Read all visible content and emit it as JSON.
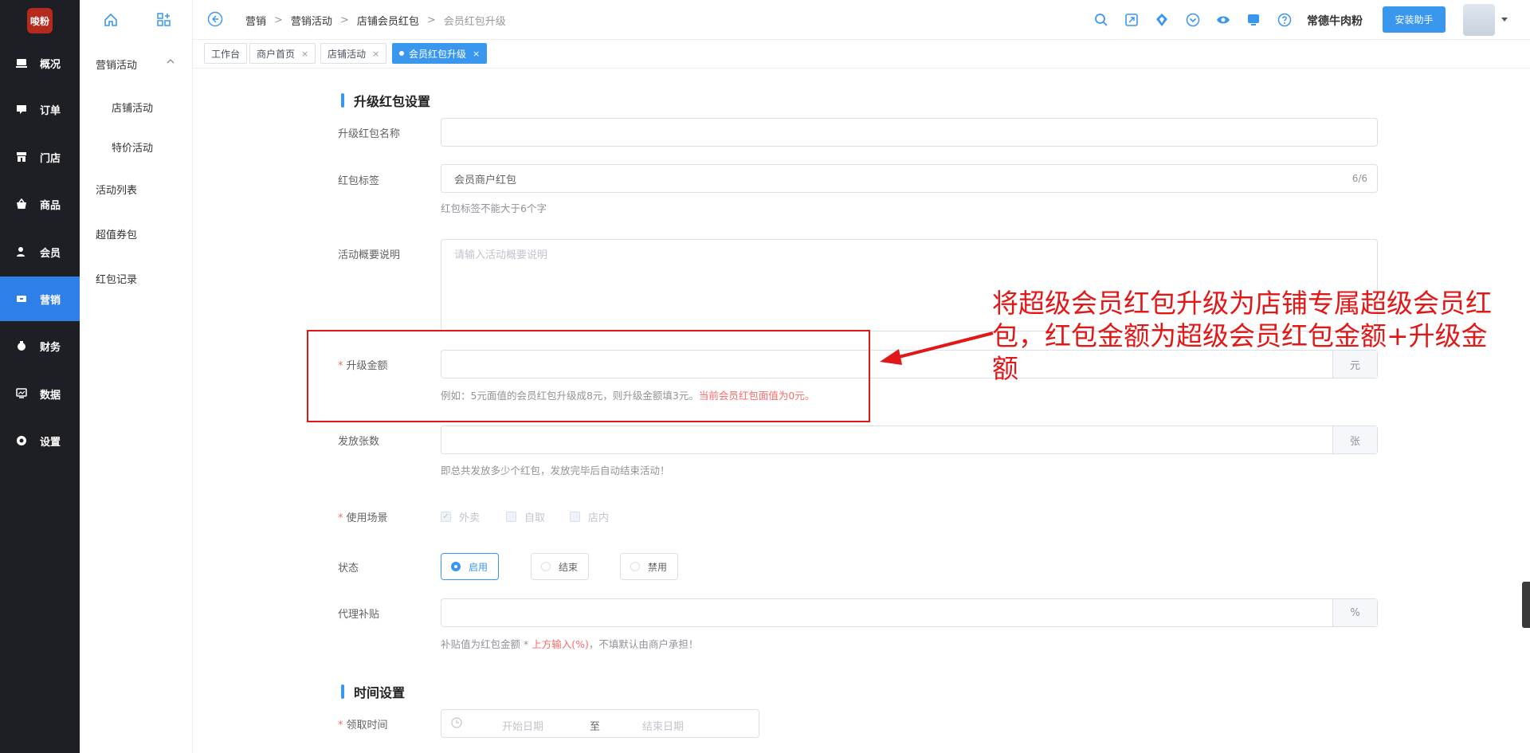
{
  "app": {
    "logo_text": "唆粉"
  },
  "nav": {
    "items": [
      {
        "label": "概况",
        "icon": "overview-icon"
      },
      {
        "label": "订单",
        "icon": "order-icon"
      },
      {
        "label": "门店",
        "icon": "store-icon"
      },
      {
        "label": "商品",
        "icon": "goods-icon"
      },
      {
        "label": "会员",
        "icon": "member-icon"
      },
      {
        "label": "营销",
        "icon": "marketing-icon",
        "active": true
      },
      {
        "label": "财务",
        "icon": "finance-icon"
      },
      {
        "label": "数据",
        "icon": "data-icon"
      },
      {
        "label": "设置",
        "icon": "settings-icon"
      }
    ]
  },
  "subnav": {
    "group": "营销活动",
    "children": [
      "店铺活动",
      "特价活动"
    ],
    "items": [
      "活动列表",
      "超值券包",
      "红包记录"
    ]
  },
  "breadcrumb": {
    "items": [
      "营销",
      "营销活动",
      "店铺会员红包"
    ],
    "current": "会员红包升级"
  },
  "header": {
    "shop_name": "常德牛肉粉",
    "helper_button": "安装助手"
  },
  "tabs": [
    {
      "label": "工作台",
      "closable": false
    },
    {
      "label": "商户首页",
      "closable": true
    },
    {
      "label": "店铺活动",
      "closable": true
    },
    {
      "label": "会员红包升级",
      "closable": true,
      "active": true
    }
  ],
  "form": {
    "section1_title": "升级红包设置",
    "name_label": "升级红包名称",
    "name_value": "",
    "tag_label": "红包标签",
    "tag_value": "会员商户红包",
    "tag_count": "6/6",
    "tag_hint": "红包标签不能大于6个字",
    "desc_label": "活动概要说明",
    "desc_placeholder": "请输入活动概要说明",
    "amount_label": "升级金额",
    "amount_suffix": "元",
    "amount_hint": "例如：5元面值的会员红包升级成8元，则升级金额填3元。",
    "amount_hint_red": "当前会员红包面值为0元。",
    "qty_label": "发放张数",
    "qty_suffix": "张",
    "qty_hint": "即总共发放多少个红包，发放完毕后自动结束活动！",
    "scene_label": "使用场景",
    "scene_options": [
      "外卖",
      "自取",
      "店内"
    ],
    "status_label": "状态",
    "status_options": [
      "启用",
      "结束",
      "禁用"
    ],
    "status_selected": "启用",
    "subsidy_label": "代理补贴",
    "subsidy_suffix": "%",
    "subsidy_hint_a": "补贴值为红包金额 * ",
    "subsidy_hint_red": "上方输入(%)",
    "subsidy_hint_b": "，不填默认由商户承担！",
    "section2_title": "时间设置",
    "time_label": "领取时间",
    "start_placeholder": "开始日期",
    "range_sep": "至",
    "end_placeholder": "结束日期"
  },
  "annotation": {
    "text": "将超级会员红包升级为店铺专属超级会员红包，红包金额为超级会员红包金额+升级金额",
    "color": "#e01818"
  },
  "colors": {
    "accent": "#3a97ee",
    "sidebar": "#1e1f24",
    "active_nav": "#2f7fe8",
    "danger": "#f56c6c"
  }
}
